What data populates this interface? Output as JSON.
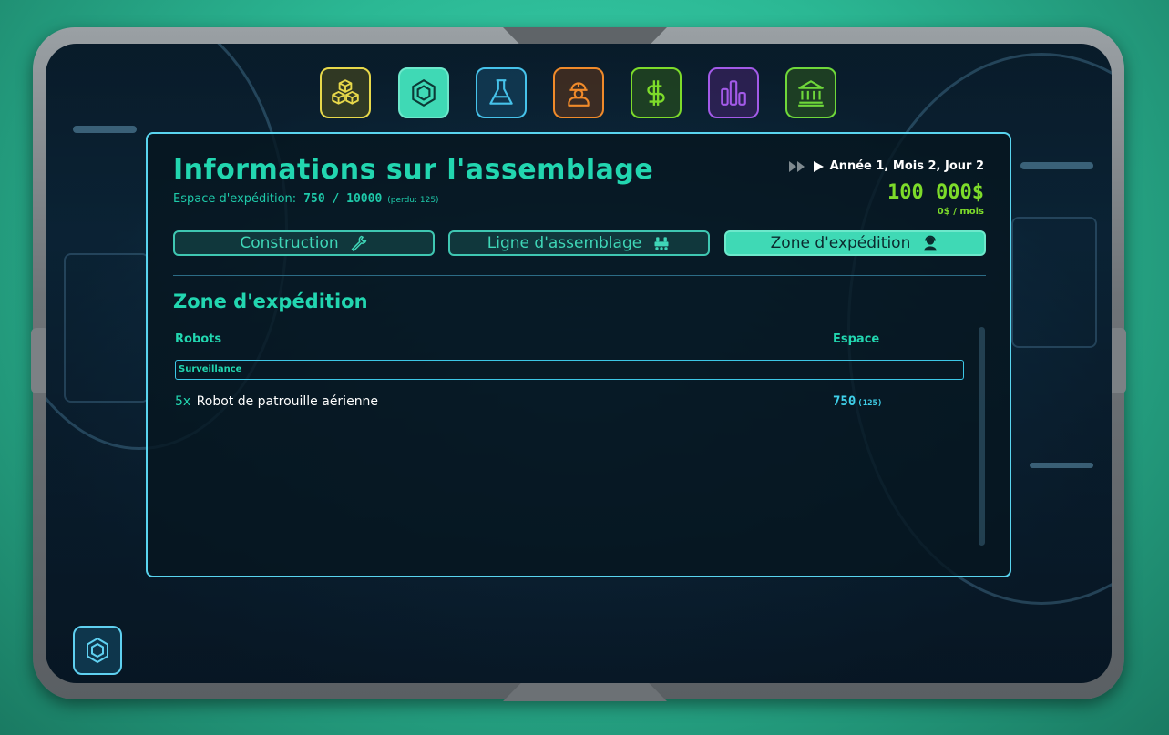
{
  "topbar": {
    "icons": [
      {
        "name": "cubes-icon",
        "color": "#e7d84a",
        "active": false
      },
      {
        "name": "hexagon-icon",
        "color": "#3fd9b5",
        "active": true
      },
      {
        "name": "flask-icon",
        "color": "#46c2ea",
        "active": false
      },
      {
        "name": "worker-icon",
        "color": "#f08a2a",
        "active": false
      },
      {
        "name": "dollar-icon",
        "color": "#7ddb2a",
        "active": false
      },
      {
        "name": "bar-chart-icon",
        "color": "#a35ae8",
        "active": false
      },
      {
        "name": "bank-icon",
        "color": "#6fd83a",
        "active": false
      }
    ]
  },
  "header": {
    "title": "Informations sur l'assemblage",
    "space_label": "Espace d'expédition:",
    "space_value": "750 / 10000",
    "space_lost": "(perdu: 125)",
    "date": "Année 1, Mois 2, Jour 2",
    "money": "100 000$",
    "monthly": "0$ / mois"
  },
  "tabs": [
    {
      "label": "Construction",
      "icon": "wrench-icon",
      "active": false
    },
    {
      "label": "Ligne d'assemblage",
      "icon": "robot-icon",
      "active": false
    },
    {
      "label": "Zone d'expédition",
      "icon": "operator-icon",
      "active": true
    }
  ],
  "section": {
    "title": "Zone d'expédition",
    "col_robots": "Robots",
    "col_space": "Espace",
    "category": "Surveillance",
    "rows": [
      {
        "qty": "5x",
        "name": "Robot de patrouille aérienne",
        "space": "750",
        "lost": "(125)"
      }
    ]
  },
  "colors": {
    "accent": "#22d6b0",
    "money": "#7ddb2a",
    "panel_border": "#59d4ef"
  }
}
